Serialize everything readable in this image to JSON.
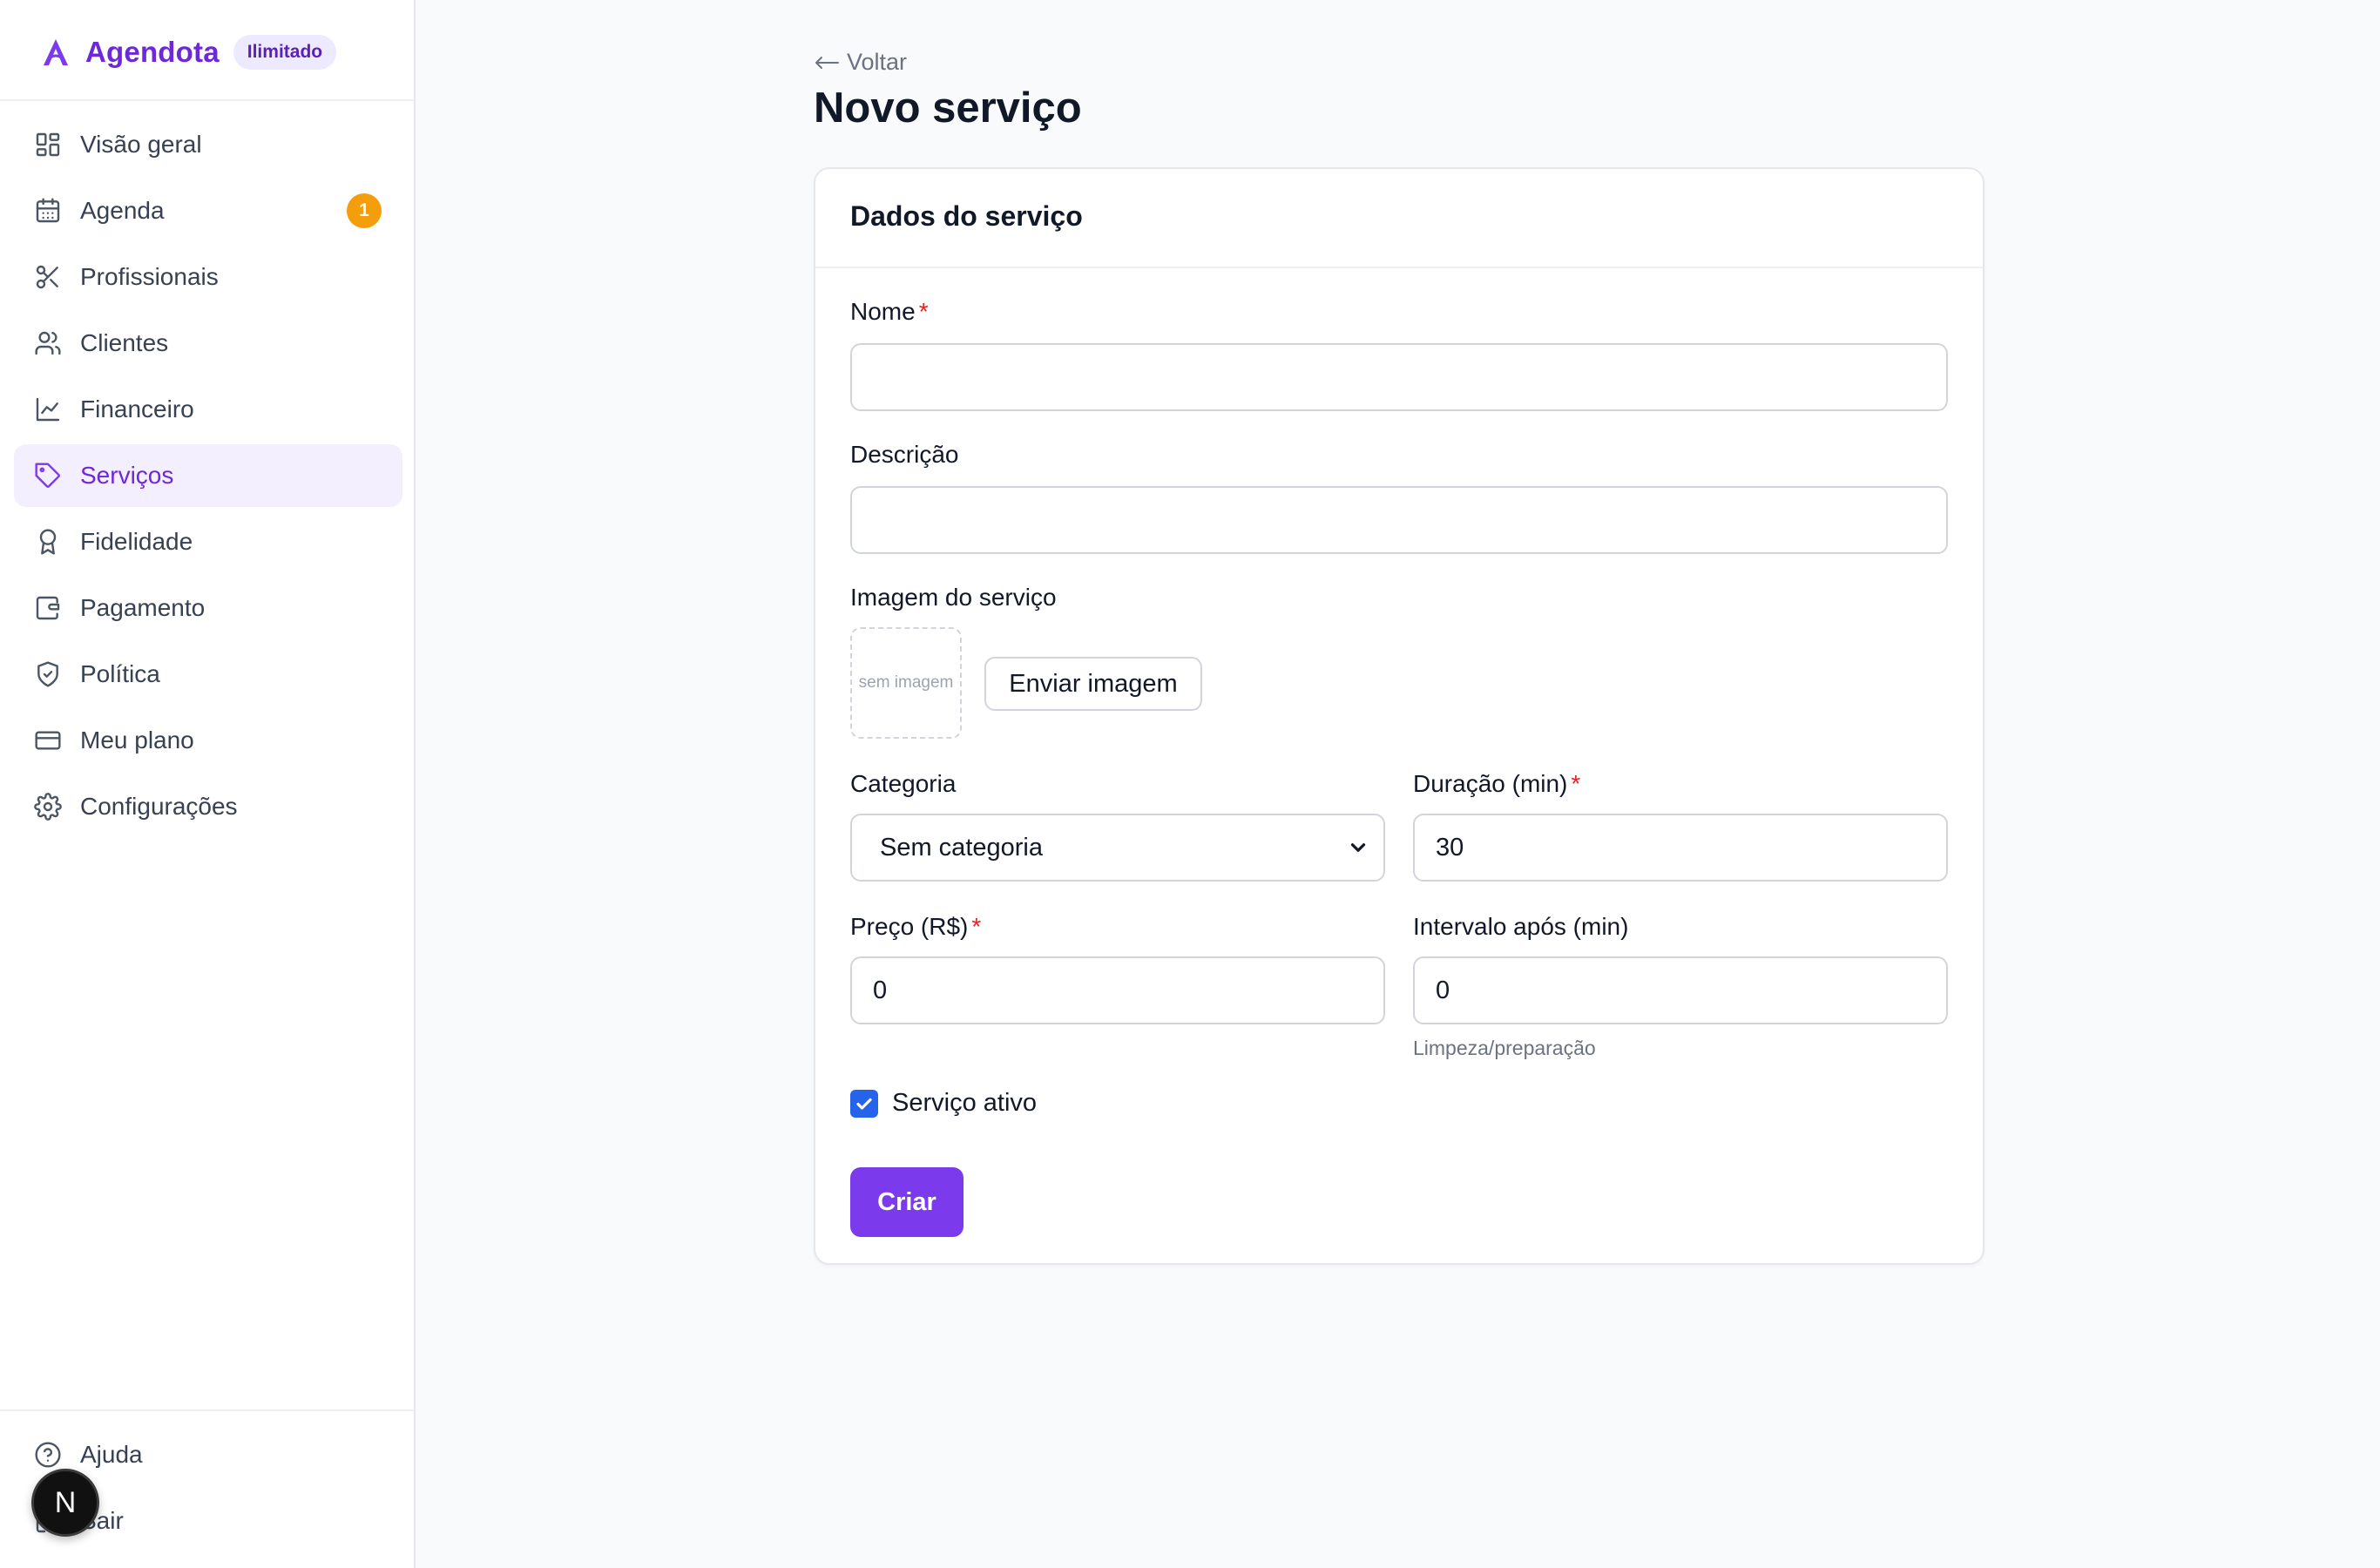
{
  "brand": {
    "name": "Agendota",
    "badge": "Ilimitado"
  },
  "sidebar": {
    "items": [
      {
        "label": "Visão geral",
        "icon": "grid-icon"
      },
      {
        "label": "Agenda",
        "icon": "calendar-icon",
        "badge": "1"
      },
      {
        "label": "Profissionais",
        "icon": "scissors-icon"
      },
      {
        "label": "Clientes",
        "icon": "users-icon"
      },
      {
        "label": "Financeiro",
        "icon": "line-chart-icon"
      },
      {
        "label": "Serviços",
        "icon": "tag-icon",
        "active": true
      },
      {
        "label": "Fidelidade",
        "icon": "award-icon"
      },
      {
        "label": "Pagamento",
        "icon": "wallet-icon"
      },
      {
        "label": "Política",
        "icon": "shield-icon"
      },
      {
        "label": "Meu plano",
        "icon": "credit-card-icon"
      },
      {
        "label": "Configurações",
        "icon": "gear-icon"
      }
    ],
    "bottom_items": [
      {
        "label": "Ajuda",
        "icon": "help-circle-icon"
      },
      {
        "label": "Sair",
        "icon": "logout-icon"
      }
    ],
    "dev_indicator": "N"
  },
  "page": {
    "back_label": "Voltar",
    "title": "Novo serviço"
  },
  "form": {
    "card_title": "Dados do serviço",
    "name_label": "Nome",
    "name_value": "",
    "description_label": "Descrição",
    "description_value": "",
    "image_label": "Imagem do serviço",
    "image_placeholder": "sem imagem",
    "upload_button": "Enviar imagem",
    "category_label": "Categoria",
    "category_value": "Sem categoria",
    "duration_label": "Duração (min)",
    "duration_value": "30",
    "price_label": "Preço (R$)",
    "price_value": "0",
    "interval_label": "Intervalo após (min)",
    "interval_value": "0",
    "interval_hint": "Limpeza/preparação",
    "active_label": "Serviço ativo",
    "active_checked": true,
    "submit_label": "Criar",
    "required_mark": "*"
  },
  "colors": {
    "accent": "#7c3aed",
    "accent_light": "#f3effe",
    "badge": "#f59e0b",
    "checkbox": "#2563eb",
    "required": "#dc2626"
  }
}
